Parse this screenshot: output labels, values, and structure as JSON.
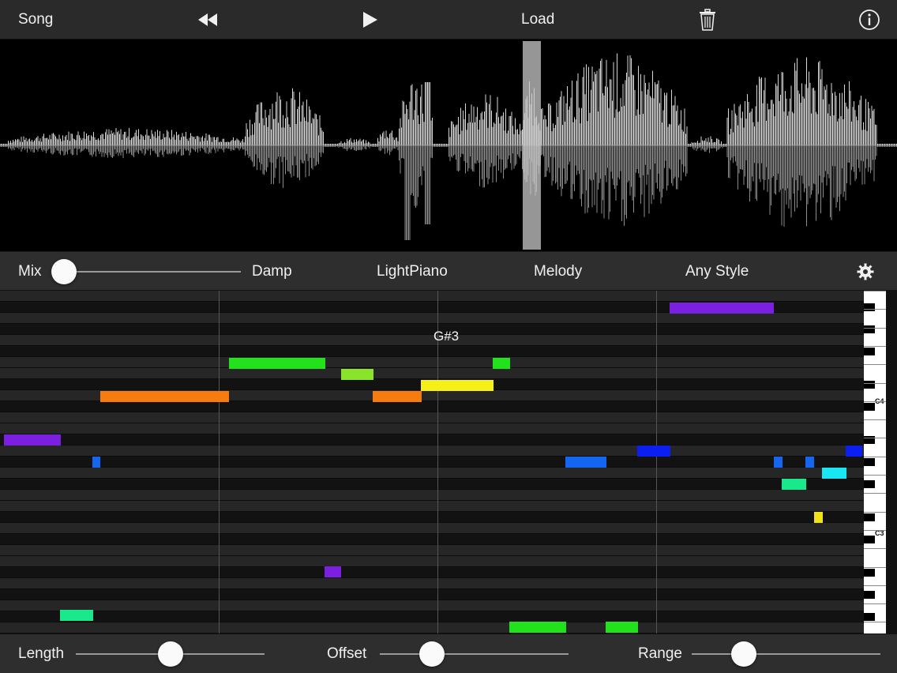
{
  "toolbar": {
    "song_label": "Song",
    "rewind_icon": "rewind-icon",
    "play_icon": "play-icon",
    "load_label": "Load",
    "trash_icon": "trash-icon",
    "info_icon": "info-icon"
  },
  "controls": {
    "mix_label": "Mix",
    "mix_value": 0.0,
    "damp_label": "Damp",
    "instrument": "LightPiano",
    "part": "Melody",
    "style": "Any Style",
    "settings_icon": "gear-icon"
  },
  "piano_roll": {
    "pitch_label": "G#3",
    "key_labels": [
      "C4",
      "C3"
    ]
  },
  "bottom": {
    "length_label": "Length",
    "length_value": 0.5,
    "offset_label": "Offset",
    "offset_value": 0.28,
    "range_label": "Range",
    "range_value": 0.28
  },
  "colors": {
    "purple": "#7b1fe0",
    "green": "#22e31b",
    "lime": "#8ae52a",
    "orange": "#f77c10",
    "yellow": "#f5f018",
    "blue": "#1466f0",
    "darkblue": "#0a1ff0",
    "cyan": "#18e6f2",
    "teal": "#19e98a",
    "gold": "#f2e01a"
  }
}
